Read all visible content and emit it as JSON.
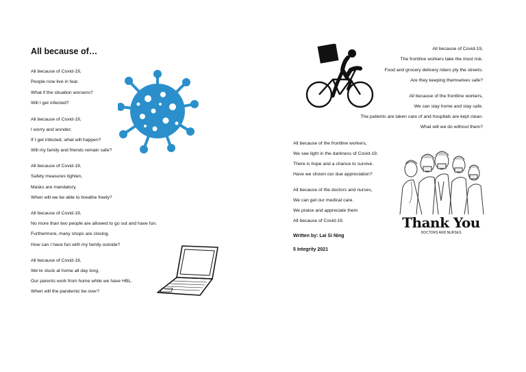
{
  "title": "All because of…",
  "left_stanzas": [
    [
      "All because of Covid-19,",
      "People now live in fear.",
      "What if the situation worsens?",
      "Will I get infected?"
    ],
    [
      "All because of Covid-19,",
      "I worry and wonder;",
      "If I get infected, what will happen?",
      "Will my family and friends remain safe?"
    ],
    [
      "All because of Covid-19,",
      "Safety measures tighten,",
      "Masks are mandatory,",
      "When will we be able to breathe freely?"
    ],
    [
      "All because of Covid-19,",
      "No more than two people are allowed to go out and have fun.",
      "Furthermore, many shops are closing.",
      "How can I have fun with my family outside?"
    ],
    [
      "All because of Covid-19,",
      "We’re stuck at home all day long,",
      "Our parents work from home while we have HBL.",
      "When will the pandemic be over?"
    ]
  ],
  "right_stanzas": [
    [
      "All because of Covid-19,",
      "The frontline workers take the most risk.",
      "Food and grocery delivery riders ply the streets.",
      "Are they keeping themselves safe?"
    ],
    [
      "All because of the frontline workers,",
      "We can stay home and stay safe.",
      "The patients are taken care of and hospitals are kept clean.",
      "What will we do without them?"
    ]
  ],
  "middle_stanzas": [
    [
      "All because of the frontline workers,",
      "We see light in the darkness of Covid-19.",
      "There is hope and a chance to survive.",
      "Have we shown our due appreciation?"
    ],
    [
      "All because of the doctors and nurses,",
      "We can get our medical care.",
      "We praise and appreciate them",
      "All because of Covid-19."
    ]
  ],
  "credits": {
    "author": "Written by: Lai Si Ning",
    "class": "5 Integrity 2021"
  },
  "thank_you": {
    "heading": "Thank You",
    "sub": "DOCTORS AND NURSES"
  },
  "colors": {
    "virus": "#2a8fcb",
    "text": "#111111"
  },
  "icons": [
    "virus-icon",
    "laptop-icon",
    "delivery-cyclist-icon",
    "medical-workers-illustration"
  ]
}
